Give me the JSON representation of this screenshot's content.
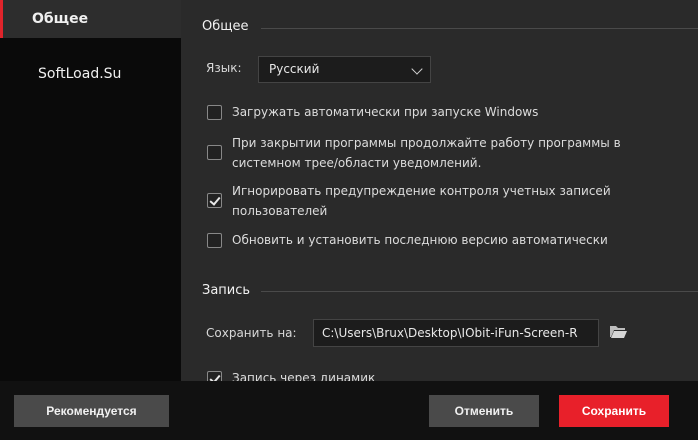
{
  "sidebar": {
    "items": [
      {
        "label": "Общее"
      },
      {
        "label": "SoftLoad.Su"
      }
    ]
  },
  "general": {
    "title": "Общее",
    "language_label": "Язык:",
    "language_value": "Русский",
    "options": [
      {
        "label": "Загружать автоматически при запуске Windows",
        "checked": false
      },
      {
        "label": "При закрытии программы продолжайте работу программы в системном трее/области уведомлений.",
        "checked": false
      },
      {
        "label": "Игнорировать предупреждение контроля учетных записей пользователей",
        "checked": true
      },
      {
        "label": "Обновить и установить последнюю версию автоматически",
        "checked": false
      }
    ]
  },
  "record": {
    "title": "Запись",
    "save_label": "Сохранить на:",
    "save_path": "C:\\Users\\Brux\\Desktop\\IObit-iFun-Screen-R",
    "speaker_option": {
      "label": "Запись через динамик",
      "checked": true
    }
  },
  "buttons": {
    "recommended": "Рекомендуется",
    "cancel": "Отменить",
    "save": "Сохранить"
  },
  "colors": {
    "accent": "#e8202a"
  },
  "icons": {
    "folder": "folder-icon",
    "dropdown": "chevron-down-icon",
    "check": "checkmark-icon"
  }
}
